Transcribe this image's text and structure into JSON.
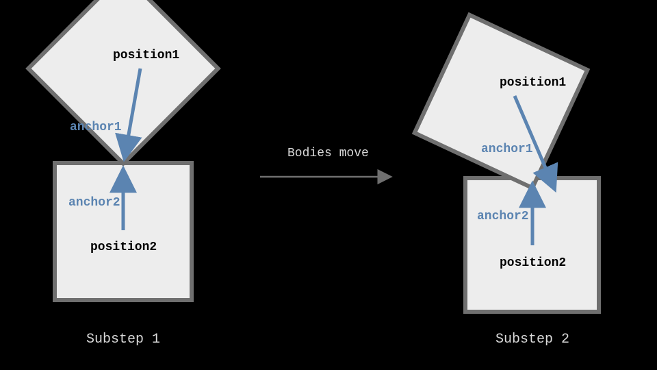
{
  "left": {
    "position1": "position1",
    "anchor1": "anchor1",
    "anchor2": "anchor2",
    "position2": "position2",
    "caption": "Substep 1"
  },
  "right": {
    "position1": "position1",
    "anchor1": "anchor1",
    "anchor2": "anchor2",
    "position2": "position2",
    "caption": "Substep 2"
  },
  "transition": {
    "label": "Bodies move"
  },
  "colors": {
    "box_fill": "#EDEDED",
    "box_stroke": "#6F6F6F",
    "arrow": "#5B84B1",
    "text_light": "#D9D9D9"
  }
}
